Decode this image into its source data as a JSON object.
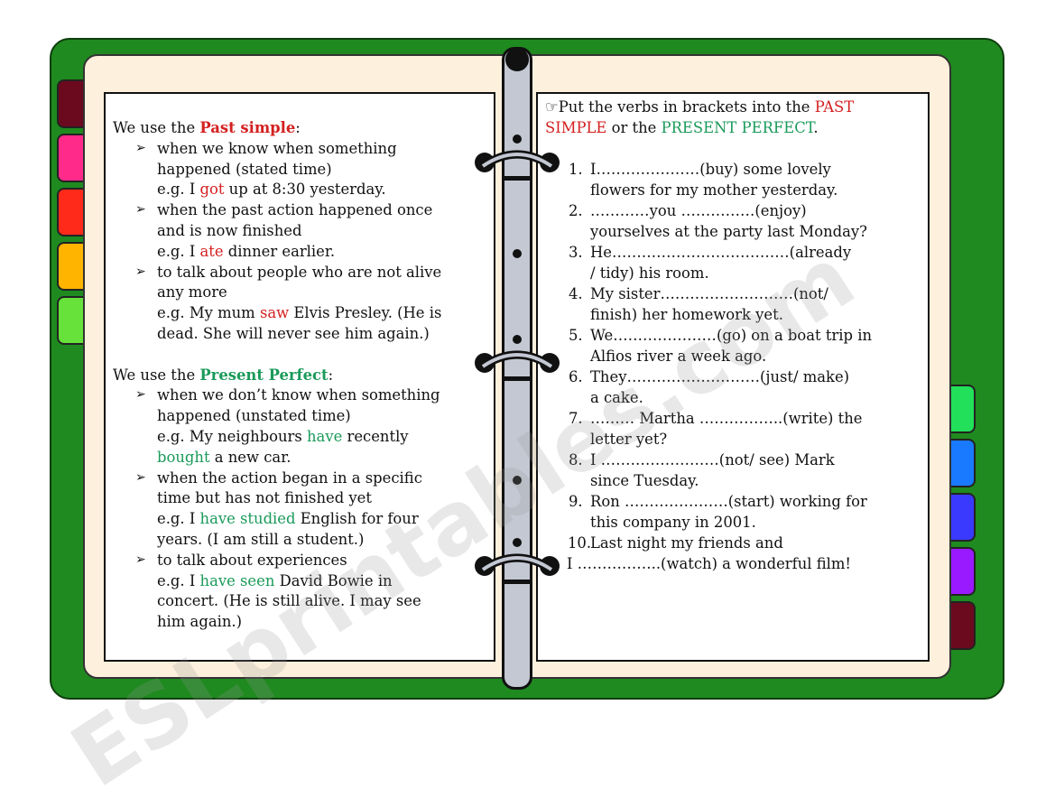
{
  "colors": {
    "cover": "#1f8a1f",
    "page": "#fdf0dc",
    "past": "#d42020",
    "present": "#1a9a5a"
  },
  "tabs_left": [
    "#6b0a1e",
    "#ff2a8a",
    "#ff2a1a",
    "#ffb400",
    "#66e23a"
  ],
  "tabs_right": [
    "#22e05a",
    "#1a7aff",
    "#3a3aff",
    "#9a1aff",
    "#6b0a1e"
  ],
  "watermark": "ESLprintables.com",
  "left_page": {
    "lines": [
      {
        "type": "heading",
        "segs": [
          [
            "We use the ",
            ""
          ],
          [
            "Past simple",
            "past-bold"
          ],
          [
            ":",
            ""
          ]
        ]
      },
      {
        "type": "bullet",
        "segs": [
          [
            "when we know when something",
            ""
          ]
        ]
      },
      {
        "type": "cont",
        "segs": [
          [
            "happened (stated time)",
            ""
          ]
        ]
      },
      {
        "type": "cont",
        "segs": [
          [
            "e.g. I ",
            ""
          ],
          [
            "got",
            "past"
          ],
          [
            " up at 8:30 yesterday.",
            ""
          ]
        ]
      },
      {
        "type": "bullet",
        "segs": [
          [
            "when the past action happened once",
            ""
          ]
        ]
      },
      {
        "type": "cont",
        "segs": [
          [
            "and is now finished",
            ""
          ]
        ]
      },
      {
        "type": "cont",
        "segs": [
          [
            "e.g. I ",
            ""
          ],
          [
            "ate",
            "past"
          ],
          [
            " dinner earlier.",
            ""
          ]
        ]
      },
      {
        "type": "bullet",
        "segs": [
          [
            "to talk about people who are not alive",
            ""
          ]
        ]
      },
      {
        "type": "cont",
        "segs": [
          [
            "any more",
            ""
          ]
        ]
      },
      {
        "type": "cont",
        "segs": [
          [
            "e.g. My mum ",
            ""
          ],
          [
            "saw",
            "past"
          ],
          [
            "  Elvis Presley. (He is",
            ""
          ]
        ]
      },
      {
        "type": "cont",
        "segs": [
          [
            "dead. She will never see him again.)",
            ""
          ]
        ]
      },
      {
        "type": "gap",
        "segs": []
      },
      {
        "type": "heading",
        "segs": [
          [
            "We use the ",
            ""
          ],
          [
            "Present Perfect",
            "present-bold"
          ],
          [
            ":",
            ""
          ]
        ]
      },
      {
        "type": "bullet",
        "segs": [
          [
            "when we don’t know when something",
            ""
          ]
        ]
      },
      {
        "type": "cont",
        "segs": [
          [
            "happened (unstated time)",
            ""
          ]
        ]
      },
      {
        "type": "cont",
        "segs": [
          [
            "e.g. My neighbours ",
            ""
          ],
          [
            "have",
            "present"
          ],
          [
            " recently",
            ""
          ]
        ]
      },
      {
        "type": "cont",
        "segs": [
          [
            "bought",
            "present"
          ],
          [
            " a new car.",
            ""
          ]
        ]
      },
      {
        "type": "bullet",
        "segs": [
          [
            "when the action began in a specific",
            ""
          ]
        ]
      },
      {
        "type": "cont",
        "segs": [
          [
            "time but has not finished yet",
            ""
          ]
        ]
      },
      {
        "type": "cont",
        "segs": [
          [
            "e.g. I ",
            ""
          ],
          [
            "have studied",
            "present"
          ],
          [
            " English for four",
            ""
          ]
        ]
      },
      {
        "type": "cont",
        "segs": [
          [
            "years. (I am still a student.)",
            ""
          ]
        ]
      },
      {
        "type": "bullet",
        "segs": [
          [
            "to talk about experiences",
            ""
          ]
        ]
      },
      {
        "type": "cont",
        "segs": [
          [
            "e.g. I ",
            ""
          ],
          [
            "have seen",
            "present"
          ],
          [
            " David Bowie in",
            ""
          ]
        ]
      },
      {
        "type": "cont",
        "segs": [
          [
            "concert. (He is still alive. I may see",
            ""
          ]
        ]
      },
      {
        "type": "cont",
        "segs": [
          [
            "him again.)",
            ""
          ]
        ]
      }
    ]
  },
  "right_page": {
    "lines": [
      {
        "type": "heading",
        "segs": [
          [
            "☞Put the verbs in brackets into the ",
            ""
          ],
          [
            "PAST",
            "past"
          ]
        ]
      },
      {
        "type": "heading",
        "segs": [
          [
            "SIMPLE",
            "past"
          ],
          [
            " or the ",
            ""
          ],
          [
            "PRESENT PERFECT",
            "present"
          ],
          [
            ".",
            ""
          ]
        ]
      },
      {
        "type": "gap",
        "segs": []
      },
      {
        "type": "item",
        "num": "1.",
        "segs": [
          [
            " I…………………(buy) some lovely",
            ""
          ]
        ]
      },
      {
        "type": "cont",
        "segs": [
          [
            "flowers for my mother yesterday.",
            ""
          ]
        ]
      },
      {
        "type": "item",
        "num": "2.",
        "segs": [
          [
            "…………you ……………(enjoy)",
            ""
          ]
        ]
      },
      {
        "type": "cont",
        "segs": [
          [
            "yourselves at the party last Monday?",
            ""
          ]
        ]
      },
      {
        "type": "item",
        "num": "3.",
        "segs": [
          [
            "He………………………………(already",
            ""
          ]
        ]
      },
      {
        "type": "cont",
        "segs": [
          [
            "/ tidy) his room.",
            ""
          ]
        ]
      },
      {
        "type": "item",
        "num": "4.",
        "segs": [
          [
            "My sister………………………(not/",
            ""
          ]
        ]
      },
      {
        "type": "cont",
        "segs": [
          [
            "finish) her homework yet.",
            ""
          ]
        ]
      },
      {
        "type": "item",
        "num": "5.",
        "segs": [
          [
            "We…………………(go) on a boat trip in",
            ""
          ]
        ]
      },
      {
        "type": "cont",
        "segs": [
          [
            "Alfios river a week ago.",
            ""
          ]
        ]
      },
      {
        "type": "item",
        "num": "6.",
        "segs": [
          [
            "They………………………(just/ make)",
            ""
          ]
        ]
      },
      {
        "type": "cont",
        "segs": [
          [
            "a cake.",
            ""
          ]
        ]
      },
      {
        "type": "item",
        "num": "7.",
        "segs": [
          [
            "……… Martha ……………..(write) the",
            ""
          ]
        ]
      },
      {
        "type": "cont",
        "segs": [
          [
            "letter yet?",
            ""
          ]
        ]
      },
      {
        "type": "item",
        "num": "8.",
        "segs": [
          [
            "I ……………………(not/  see) Mark",
            ""
          ]
        ]
      },
      {
        "type": "cont",
        "segs": [
          [
            "since Tuesday.",
            ""
          ]
        ]
      },
      {
        "type": "item",
        "num": "9.",
        "segs": [
          [
            "Ron …………………(start) working for",
            ""
          ]
        ]
      },
      {
        "type": "cont",
        "segs": [
          [
            "this company in 2001.",
            ""
          ]
        ]
      },
      {
        "type": "item",
        "num": "10.",
        "segs": [
          [
            "Last night my friends and",
            ""
          ]
        ]
      },
      {
        "type": "outdent",
        "segs": [
          [
            "I ……………..(watch) a      wonderful film!",
            ""
          ]
        ]
      }
    ]
  }
}
